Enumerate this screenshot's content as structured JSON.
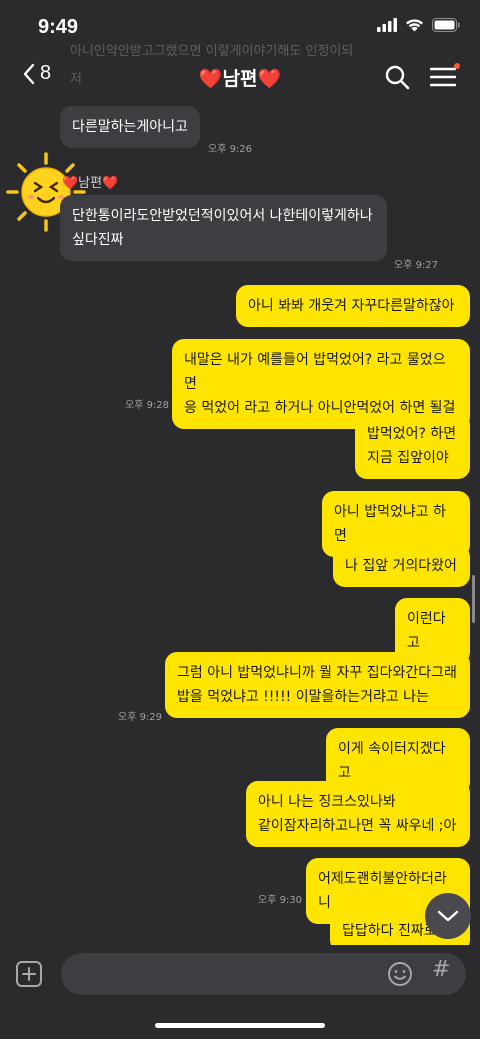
{
  "status": {
    "time": "9:49"
  },
  "notification_ghost": {
    "line1": "아니인약안받고그랬으면 이렇게이야기해도 인정이되",
    "line2": "저"
  },
  "header": {
    "back_count": "8",
    "title": "❤️남편❤️"
  },
  "sender": {
    "name": "❤️남편❤️"
  },
  "messages": [
    {
      "dir": "in",
      "text": "다른말하는게아니고",
      "time": ""
    },
    {
      "dir": "in",
      "text": "",
      "time": "오후 9:26"
    },
    {
      "dir": "in",
      "text": "단한통이라도안받었던적이있어서 나한테이렇게하나\n싶다진짜",
      "time": "오후 9:27"
    },
    {
      "dir": "out",
      "text": "아니 봐봐 개웃겨 자꾸다른말하잖아",
      "time": ""
    },
    {
      "dir": "out",
      "text": "내말은 내가 예를들어 밥먹었어? 라고 물었으면\n응 먹었어 라고 하거나 아니안먹었어 하면 될걸",
      "time": "오후 9:28"
    },
    {
      "dir": "out",
      "text": "밥먹었어? 하면\n지금 집앞이야",
      "time": ""
    },
    {
      "dir": "out",
      "text": "아니 밥먹었냐고 하면",
      "time": ""
    },
    {
      "dir": "out",
      "text": "나 집앞 거의다왔어",
      "time": ""
    },
    {
      "dir": "out",
      "text": "이런다고",
      "time": ""
    },
    {
      "dir": "out",
      "text": "그럼 아니 밥먹었냐니까 뭘 자꾸 집다와간다그래\n밥을 먹었냐고 !!!!! 이말을하는거랴고 나는",
      "time": "오후 9:29"
    },
    {
      "dir": "out",
      "text": "이게 속이터지겠다고",
      "time": ""
    },
    {
      "dir": "out",
      "text": "아니 나는 징크스있나봐\n같이잠자리하고나면 꼭 싸우네 ;아",
      "time": ""
    },
    {
      "dir": "out",
      "text": "어제도괜히불안하더라니",
      "time": "오후 9:30"
    },
    {
      "dir": "out",
      "text": "답답하다 진짜로",
      "time": ""
    }
  ],
  "input": {
    "placeholder": ""
  },
  "colors": {
    "background": "#2b2b2d",
    "bubble_in": "#3e3e42",
    "bubble_out": "#fee500"
  }
}
